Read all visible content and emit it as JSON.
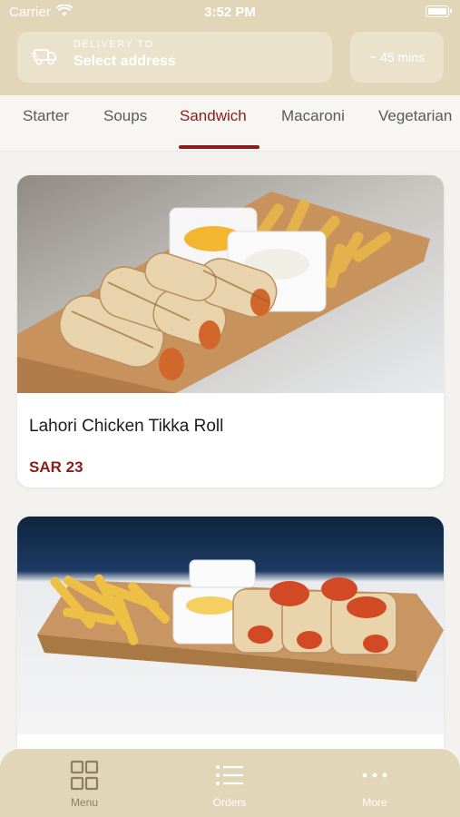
{
  "status_bar": {
    "carrier": "Carrier",
    "time": "3:52 PM"
  },
  "delivery": {
    "caption": "DELIVERY TO",
    "address": "Select address",
    "eta": "~ 45 mins"
  },
  "categories": [
    "Starter",
    "Soups",
    "Sandwich",
    "Macaroni",
    "Vegetarian"
  ],
  "active_category": "Sandwich",
  "products": [
    {
      "name": "Lahori Chicken Tikka Roll",
      "price": "SAR 23",
      "image_icon": "chicken-tikka-roll-photo"
    },
    {
      "name": "",
      "price": "",
      "image_icon": "wraps-platter-photo"
    }
  ],
  "bottom_nav": [
    {
      "label": "Menu",
      "icon": "grid-icon",
      "active": true
    },
    {
      "label": "Orders",
      "icon": "list-icon",
      "active": false
    },
    {
      "label": "More",
      "icon": "more-dots-icon",
      "active": false
    }
  ],
  "colors": {
    "accent": "#8a1c1c",
    "header_bg": "#e2d6b9",
    "page_bg": "#f3f2ef"
  }
}
